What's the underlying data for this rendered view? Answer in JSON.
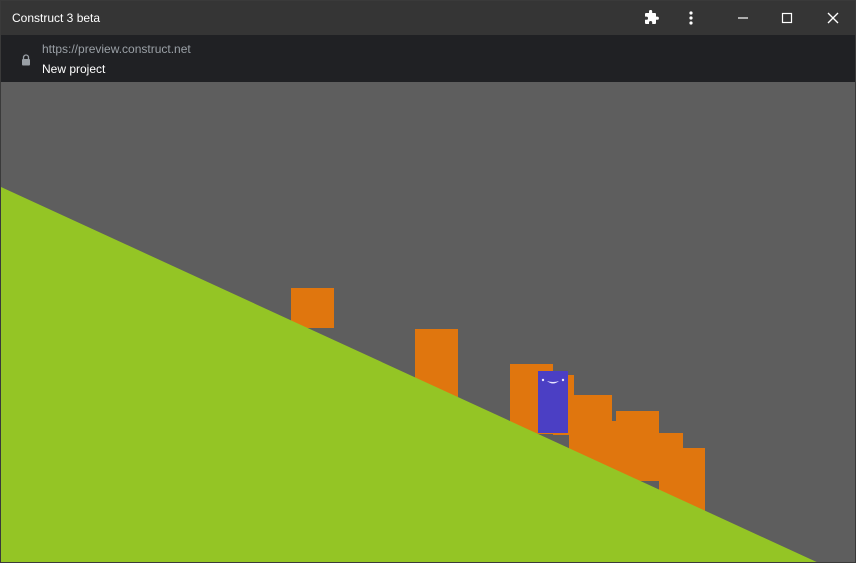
{
  "window": {
    "title": "Construct 3 beta",
    "controls": {
      "extensions_icon": "puzzle-icon",
      "menu_icon": "kebab-menu-icon",
      "minimize_icon": "minimize-icon",
      "maximize_icon": "maximize-icon",
      "close_icon": "close-icon"
    }
  },
  "address_bar": {
    "lock_icon": "lock-icon",
    "url": "https://preview.construct.net",
    "page_title": "New project"
  },
  "colors": {
    "titlebar": "#353535",
    "address_bar": "#202124",
    "game_background": "#5e5e5e",
    "ground": "#94c525",
    "crates": "#e0760e",
    "player": "#4b3fc4"
  }
}
